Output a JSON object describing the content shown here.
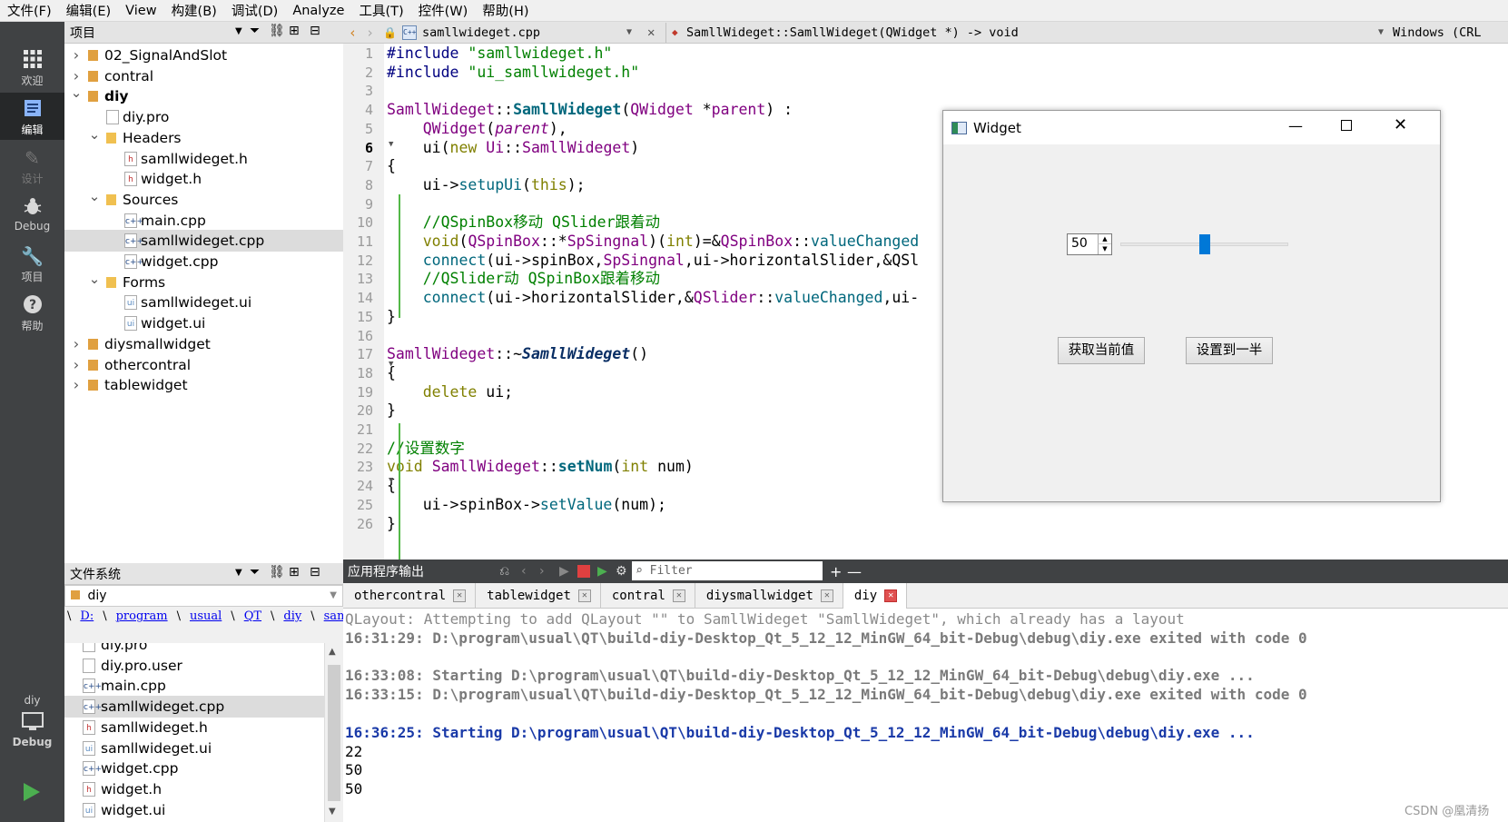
{
  "menu": [
    "文件(F)",
    "编辑(E)",
    "View",
    "构建(B)",
    "调试(D)",
    "Analyze",
    "工具(T)",
    "控件(W)",
    "帮助(H)"
  ],
  "modes": [
    {
      "label": "欢迎",
      "icon": "grid-icon"
    },
    {
      "label": "编辑",
      "icon": "edit-icon"
    },
    {
      "label": "设计",
      "icon": "pen-icon"
    },
    {
      "label": "Debug",
      "icon": "bug-icon"
    },
    {
      "label": "项目",
      "icon": "wrench-icon"
    },
    {
      "label": "帮助",
      "icon": "help-icon"
    }
  ],
  "kit": {
    "project": "diy",
    "config": "Debug"
  },
  "project_panel": {
    "title": "项目",
    "items": [
      {
        "label": "02_SignalAndSlot",
        "level": 0,
        "chevron": "right",
        "icon": "project-icon",
        "bold": false
      },
      {
        "label": "contral",
        "level": 0,
        "chevron": "right",
        "icon": "project-icon",
        "bold": false
      },
      {
        "label": "diy",
        "level": 0,
        "chevron": "down",
        "icon": "project-icon",
        "bold": true
      },
      {
        "label": "diy.pro",
        "level": 1,
        "chevron": "",
        "icon": "pro-file-icon",
        "bold": false
      },
      {
        "label": "Headers",
        "level": 1,
        "chevron": "down",
        "icon": "folder-icon",
        "bold": false
      },
      {
        "label": "samllwideget.h",
        "level": 2,
        "chevron": "",
        "icon": "header-file-icon",
        "bold": false
      },
      {
        "label": "widget.h",
        "level": 2,
        "chevron": "",
        "icon": "header-file-icon",
        "bold": false
      },
      {
        "label": "Sources",
        "level": 1,
        "chevron": "down",
        "icon": "folder-icon",
        "bold": false
      },
      {
        "label": "main.cpp",
        "level": 2,
        "chevron": "",
        "icon": "cpp-file-icon",
        "bold": false
      },
      {
        "label": "samllwideget.cpp",
        "level": 2,
        "chevron": "",
        "icon": "cpp-file-icon",
        "bold": false,
        "selected": true
      },
      {
        "label": "widget.cpp",
        "level": 2,
        "chevron": "",
        "icon": "cpp-file-icon",
        "bold": false
      },
      {
        "label": "Forms",
        "level": 1,
        "chevron": "down",
        "icon": "folder-icon",
        "bold": false
      },
      {
        "label": "samllwideget.ui",
        "level": 2,
        "chevron": "",
        "icon": "ui-file-icon",
        "bold": false
      },
      {
        "label": "widget.ui",
        "level": 2,
        "chevron": "",
        "icon": "ui-file-icon",
        "bold": false
      },
      {
        "label": "diysmallwidget",
        "level": 0,
        "chevron": "right",
        "icon": "project-icon",
        "bold": false
      },
      {
        "label": "othercontral",
        "level": 0,
        "chevron": "right",
        "icon": "project-icon",
        "bold": false
      },
      {
        "label": "tablewidget",
        "level": 0,
        "chevron": "right",
        "icon": "project-icon",
        "bold": false
      }
    ]
  },
  "fs_panel": {
    "title": "文件系统",
    "root": "diy",
    "breadcrumb": [
      "\\",
      "D:",
      "\\",
      "program",
      "\\",
      "usual",
      "\\",
      "QT",
      "\\",
      "diy",
      "\\",
      "samllwideget.cpp"
    ],
    "files": [
      {
        "label": "diy.pro",
        "icon": "pro-file-icon"
      },
      {
        "label": "diy.pro.user",
        "icon": "user-file-icon"
      },
      {
        "label": "main.cpp",
        "icon": "cpp-file-icon"
      },
      {
        "label": "samllwideget.cpp",
        "icon": "cpp-file-icon",
        "selected": true
      },
      {
        "label": "samllwideget.h",
        "icon": "header-file-icon"
      },
      {
        "label": "samllwideget.ui",
        "icon": "ui-file-icon"
      },
      {
        "label": "widget.cpp",
        "icon": "cpp-file-icon"
      },
      {
        "label": "widget.h",
        "icon": "header-file-icon"
      },
      {
        "label": "widget.ui",
        "icon": "ui-file-icon"
      }
    ]
  },
  "editor": {
    "file": "samllwideget.cpp",
    "symbol": "SamllWideget::SamllWideget(QWidget *) -> void",
    "line_ending": "Windows (CRL",
    "lines": [
      {
        "n": "1",
        "t": "#include \"samllwideget.h\""
      },
      {
        "n": "2",
        "t": "#include \"ui_samllwideget.h\""
      },
      {
        "n": "3",
        "t": ""
      },
      {
        "n": "4",
        "t": "SamllWideget::SamllWideget(QWidget *parent) :"
      },
      {
        "n": "5",
        "t": "    QWidget(parent),"
      },
      {
        "n": "6",
        "t": "    ui(new Ui::SamllWideget)"
      },
      {
        "n": "7",
        "t": "{"
      },
      {
        "n": "8",
        "t": "    ui->setupUi(this);"
      },
      {
        "n": "9",
        "t": ""
      },
      {
        "n": "10",
        "t": "    //QSpinBox移动 QSlider跟着动"
      },
      {
        "n": "11",
        "t": "    void(QSpinBox::*SpSingnal)(int)=&QSpinBox::valueChanged"
      },
      {
        "n": "12",
        "t": "    connect(ui->spinBox,SpSingnal,ui->horizontalSlider,&QSl"
      },
      {
        "n": "13",
        "t": "    //QSlider动 QSpinBox跟着移动"
      },
      {
        "n": "14",
        "t": "    connect(ui->horizontalSlider,&QSlider::valueChanged,ui-"
      },
      {
        "n": "15",
        "t": "}"
      },
      {
        "n": "16",
        "t": ""
      },
      {
        "n": "17",
        "t": "SamllWideget::~SamllWideget()"
      },
      {
        "n": "18",
        "t": "{"
      },
      {
        "n": "19",
        "t": "    delete ui;"
      },
      {
        "n": "20",
        "t": "}"
      },
      {
        "n": "21",
        "t": ""
      },
      {
        "n": "22",
        "t": "//设置数字"
      },
      {
        "n": "23",
        "t": "void SamllWideget::setNum(int num)"
      },
      {
        "n": "24",
        "t": "{"
      },
      {
        "n": "25",
        "t": "    ui->spinBox->setValue(num);"
      },
      {
        "n": "26",
        "t": "}"
      }
    ]
  },
  "output_panel": {
    "title": "应用程序输出",
    "filter_placeholder": "Filter",
    "tabs": [
      "othercontral",
      "tablewidget",
      "contral",
      "diysmallwidget",
      "diy"
    ],
    "active_tab": "diy",
    "lines": [
      {
        "t": "QLayout: Attempting to add QLayout \"\" to SamllWideget \"SamllWideget\", which already has a layout",
        "style": "gray"
      },
      {
        "t": "16:31:29: D:\\program\\usual\\QT\\build-diy-Desktop_Qt_5_12_12_MinGW_64_bit-Debug\\debug\\diy.exe exited with code 0",
        "style": "bold-gray"
      },
      {
        "t": "",
        "style": "gray"
      },
      {
        "t": "16:33:08: Starting D:\\program\\usual\\QT\\build-diy-Desktop_Qt_5_12_12_MinGW_64_bit-Debug\\debug\\diy.exe ...",
        "style": "bold-gray"
      },
      {
        "t": "16:33:15: D:\\program\\usual\\QT\\build-diy-Desktop_Qt_5_12_12_MinGW_64_bit-Debug\\debug\\diy.exe exited with code 0",
        "style": "bold-gray"
      },
      {
        "t": "",
        "style": "gray"
      },
      {
        "t": "16:36:25: Starting D:\\program\\usual\\QT\\build-diy-Desktop_Qt_5_12_12_MinGW_64_bit-Debug\\debug\\diy.exe ...",
        "style": "bold-blue"
      },
      {
        "t": "22",
        "style": "black"
      },
      {
        "t": "50",
        "style": "black"
      },
      {
        "t": "50",
        "style": "black"
      }
    ]
  },
  "widget_window": {
    "title": "Widget",
    "spin_value": "50",
    "slider_fraction": 0.5,
    "btn_get": "获取当前值",
    "btn_half": "设置到一半"
  },
  "watermark": "CSDN @凰清扬",
  "colors": {
    "accent": "#0078d7",
    "modebar": "#404244",
    "keyword": "#808000",
    "type": "#800080",
    "function": "#00677c",
    "comment": "#008000"
  }
}
